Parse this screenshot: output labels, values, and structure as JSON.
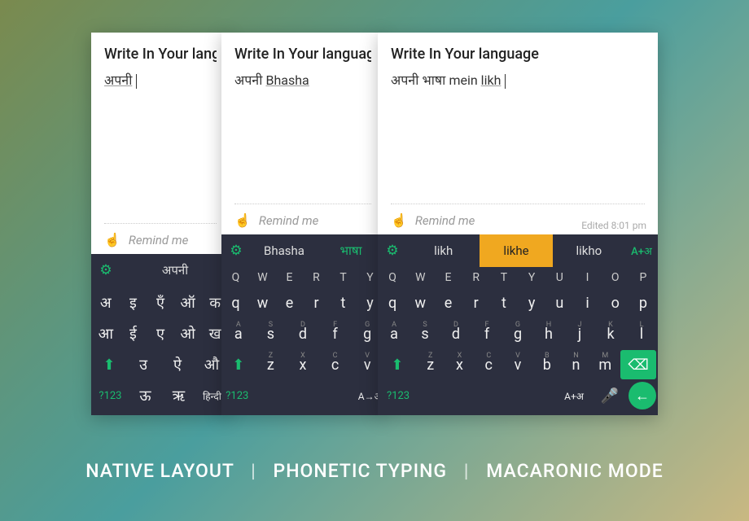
{
  "caption": {
    "a": "NATIVE LAYOUT",
    "b": "PHONETIC TYPING",
    "c": "MACARONIC MODE"
  },
  "common": {
    "title": "Write In Your language",
    "remind": "Remind me"
  },
  "screen1": {
    "body_word1": "अपनी",
    "sugg1": "अपनी",
    "num": "?123",
    "lang_key": "हिन्दी",
    "row1": [
      "अ",
      "इ",
      "एँ",
      "ऑ",
      "क"
    ],
    "row2": [
      "आ",
      "ई",
      "ए",
      "ओ",
      "ख"
    ],
    "row3": [
      "",
      "उ",
      "ऐ",
      "औ",
      ""
    ],
    "row4_extra": [
      "ऊ",
      "ऋ"
    ]
  },
  "screen2": {
    "body_pre": "अपनी ",
    "body_word": "Bhasha",
    "sugg1": "Bhasha",
    "sugg2": "भाषा",
    "num": "?123",
    "mode": "A→अ",
    "toprow": [
      "Q",
      "W",
      "E",
      "R",
      "T",
      "Y"
    ],
    "row1": [
      "q",
      "w",
      "e",
      "r",
      "t",
      "y"
    ],
    "row2_sub": [
      "A",
      "S",
      "D",
      "F",
      "G"
    ],
    "row2": [
      "a",
      "s",
      "d",
      "f",
      "g"
    ],
    "row3_sub": [
      "Z",
      "X",
      "C",
      "V"
    ],
    "row3": [
      "z",
      "x",
      "c",
      "v"
    ]
  },
  "screen3": {
    "body_pre": "अपनी भाषा ",
    "body_mid": "mein ",
    "body_word": "likh",
    "edited": "Edited 8:01 pm",
    "sugg1": "likh",
    "sugg2": "likhe",
    "sugg3": "likho",
    "badge": "A+अ",
    "num": "?123",
    "mode": "A+अ",
    "toprow": [
      "Q",
      "W",
      "E",
      "R",
      "T",
      "Y",
      "U",
      "I",
      "O",
      "P"
    ],
    "row1": [
      "q",
      "w",
      "e",
      "r",
      "t",
      "y",
      "u",
      "i",
      "o",
      "p"
    ],
    "row2_sub": [
      "A",
      "S",
      "D",
      "F",
      "G",
      "H",
      "J",
      "K",
      "L"
    ],
    "row2": [
      "a",
      "s",
      "d",
      "f",
      "g",
      "h",
      "j",
      "k",
      "l"
    ],
    "row3_sub": [
      "Z",
      "X",
      "C",
      "V",
      "B",
      "N",
      "M"
    ],
    "row3": [
      "z",
      "x",
      "c",
      "v",
      "b",
      "n",
      "m"
    ]
  }
}
